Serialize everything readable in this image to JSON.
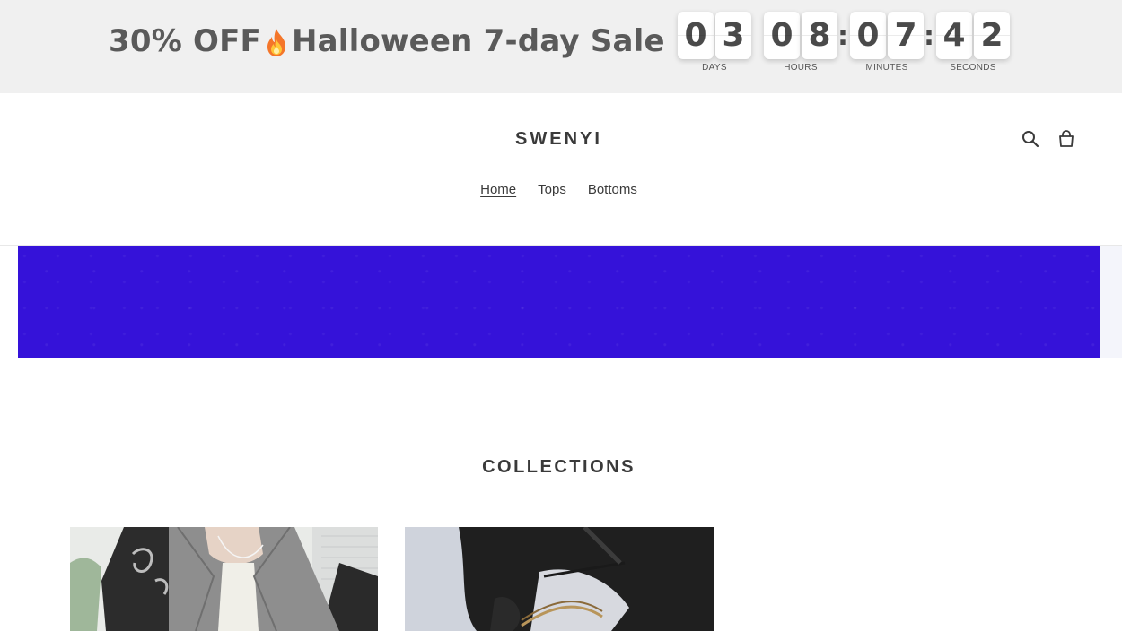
{
  "promo": {
    "text_left": "30% OFF",
    "text_right": "Halloween 7-day Sale",
    "fire_icon": "fire-emoji-icon"
  },
  "countdown": {
    "days": {
      "digits": [
        "0",
        "3"
      ],
      "label": "DAYS"
    },
    "hours": {
      "digits": [
        "0",
        "8"
      ],
      "label": "HOURS"
    },
    "minutes": {
      "digits": [
        "0",
        "7"
      ],
      "label": "MINUTES"
    },
    "seconds": {
      "digits": [
        "4",
        "2"
      ],
      "label": "SECONDS"
    },
    "separator": ":"
  },
  "header": {
    "logo": "SWENYI",
    "icons": [
      "search-icon",
      "cart-icon"
    ],
    "nav": [
      {
        "label": "Home",
        "active": true
      },
      {
        "label": "Tops",
        "active": false
      },
      {
        "label": "Bottoms",
        "active": false
      }
    ]
  },
  "hero": {
    "color": "#3512d9"
  },
  "collections": {
    "title": "COLLECTIONS",
    "cards": [
      {
        "image": "collection-image-tops"
      },
      {
        "image": "collection-image-bottoms"
      }
    ]
  }
}
